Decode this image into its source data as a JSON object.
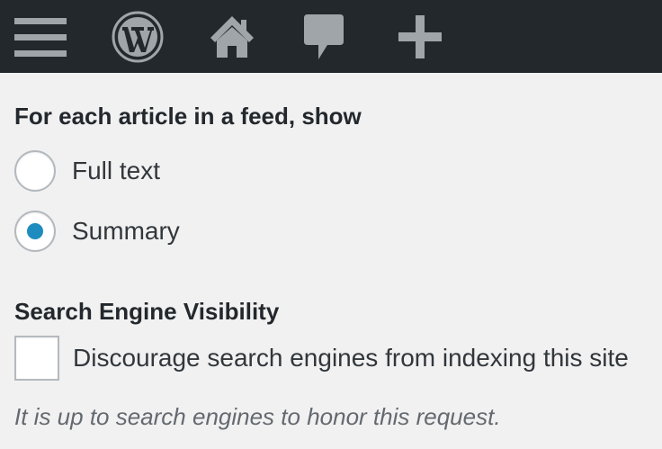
{
  "admin_bar": {
    "icons": [
      "menu-icon",
      "wordpress-logo-icon",
      "home-icon",
      "comment-icon",
      "plus-icon"
    ],
    "background_color": "#23282d",
    "icon_color": "#a0a5aa"
  },
  "feed_settings": {
    "title": "For each article in a feed, show",
    "options": [
      {
        "label": "Full text",
        "checked": false
      },
      {
        "label": "Summary",
        "checked": true
      }
    ]
  },
  "search_visibility": {
    "title": "Search Engine Visibility",
    "checkbox_label": "Discourage search engines from indexing this site",
    "checkbox_checked": false,
    "description": "It is up to search engines to honor this request."
  },
  "colors": {
    "accent": "#1e8cbe",
    "page_background": "#f1f1f1"
  }
}
